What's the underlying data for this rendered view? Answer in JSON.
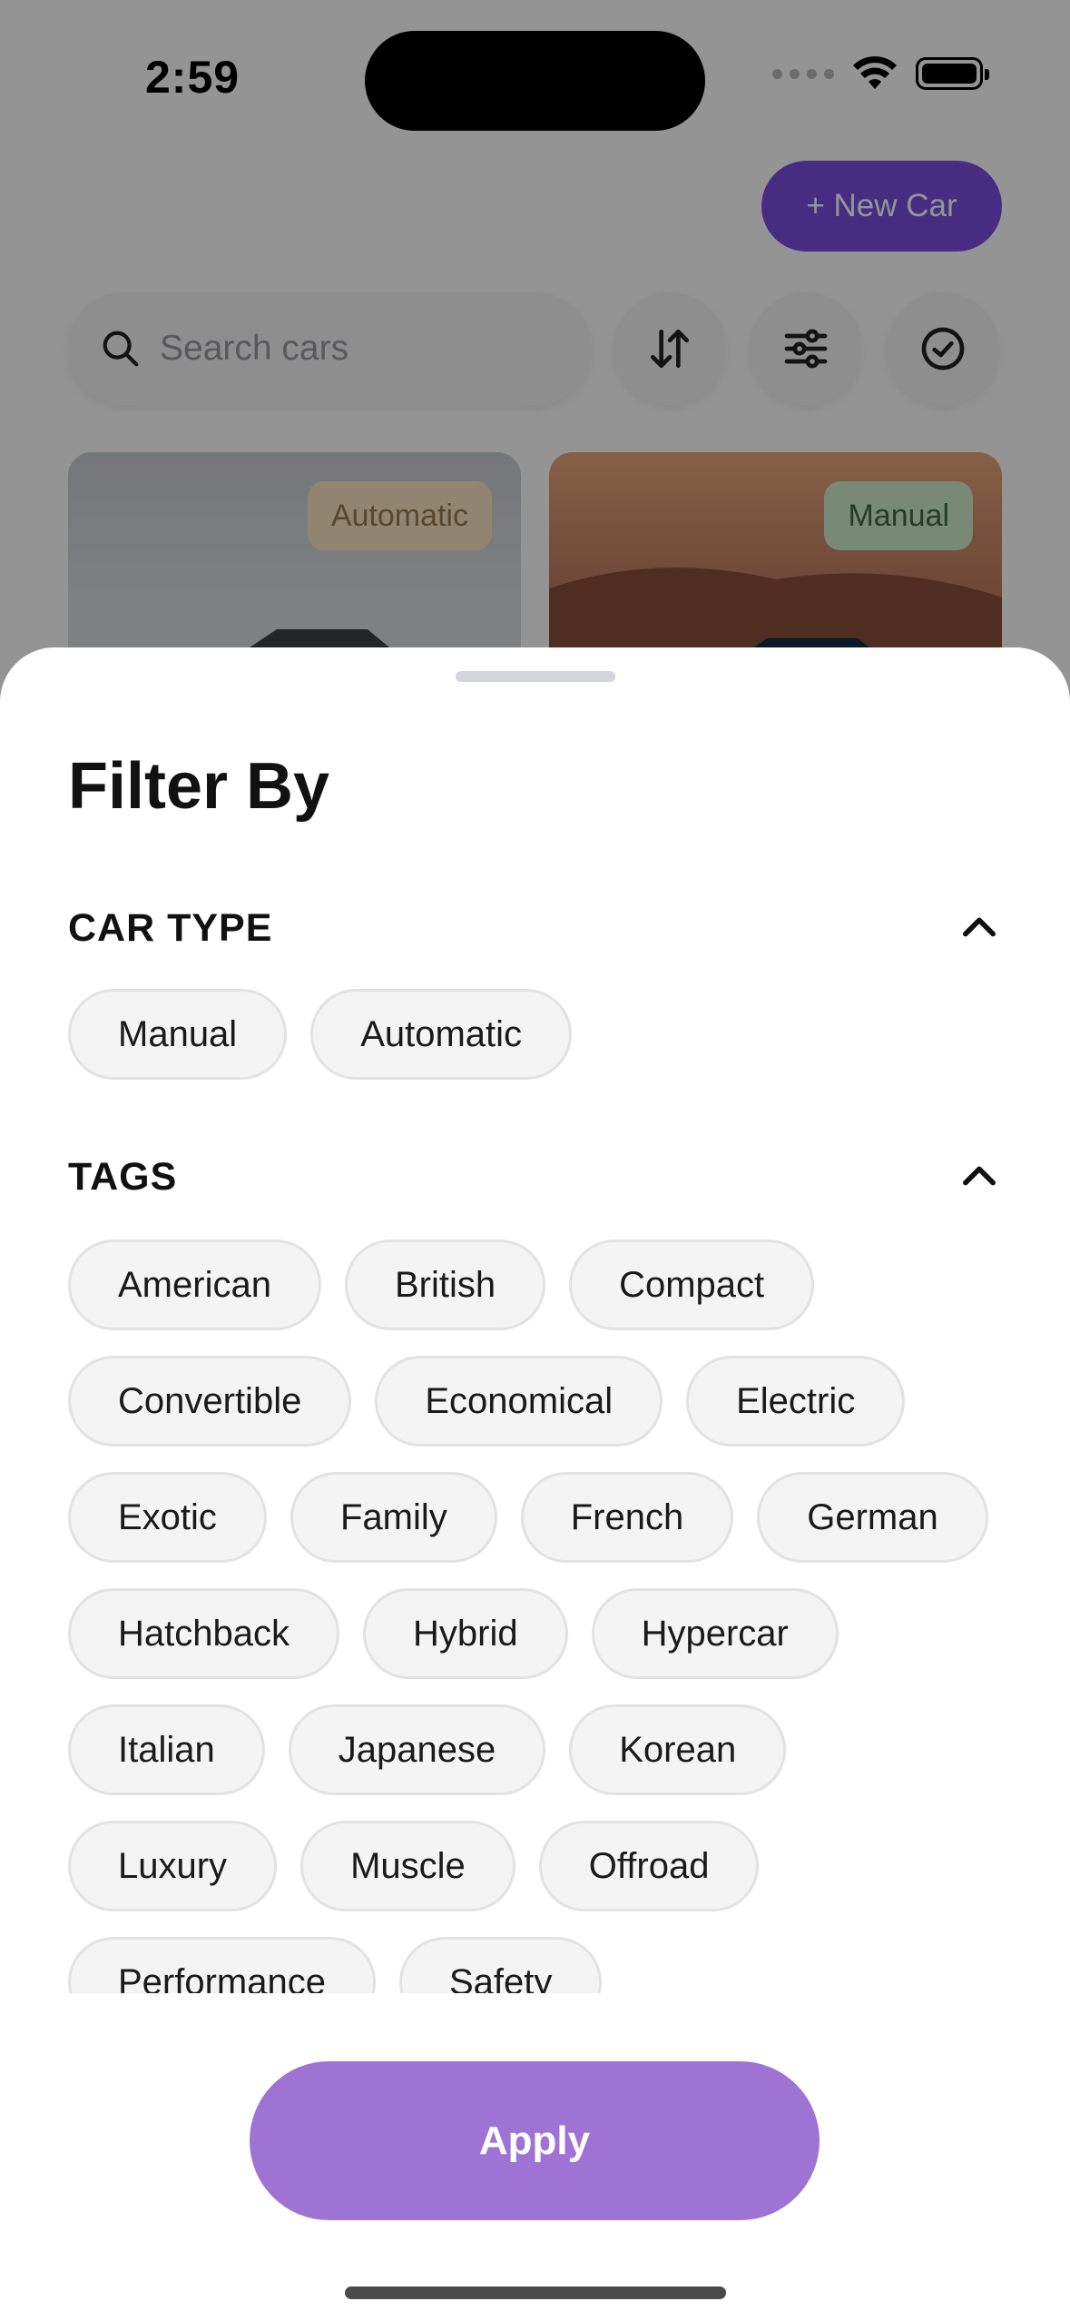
{
  "status_bar": {
    "time": "2:59"
  },
  "header": {
    "new_car_label": "+ New Car"
  },
  "search": {
    "placeholder": "Search cars"
  },
  "toolbar_icons": [
    "sort-icon",
    "sliders-icon",
    "check-circle-icon"
  ],
  "cards": [
    {
      "badge": "Automatic"
    },
    {
      "badge": "Manual"
    }
  ],
  "sheet": {
    "title": "Filter By",
    "car_type": {
      "title": "CAR TYPE",
      "options": [
        "Manual",
        "Automatic"
      ]
    },
    "tags": {
      "title": "TAGS",
      "options": [
        "American",
        "British",
        "Compact",
        "Convertible",
        "Economical",
        "Electric",
        "Exotic",
        "Family",
        "French",
        "German",
        "Hatchback",
        "Hybrid",
        "Hypercar",
        "Italian",
        "Japanese",
        "Korean",
        "Luxury",
        "Muscle",
        "Offroad",
        "Performance",
        "Safety"
      ]
    },
    "apply_label": "Apply"
  },
  "colors": {
    "accent": "#7b4ee0",
    "apply": "#9e73d4",
    "chip_bg": "#f4f4f4",
    "chip_border": "#e2e2e2"
  }
}
